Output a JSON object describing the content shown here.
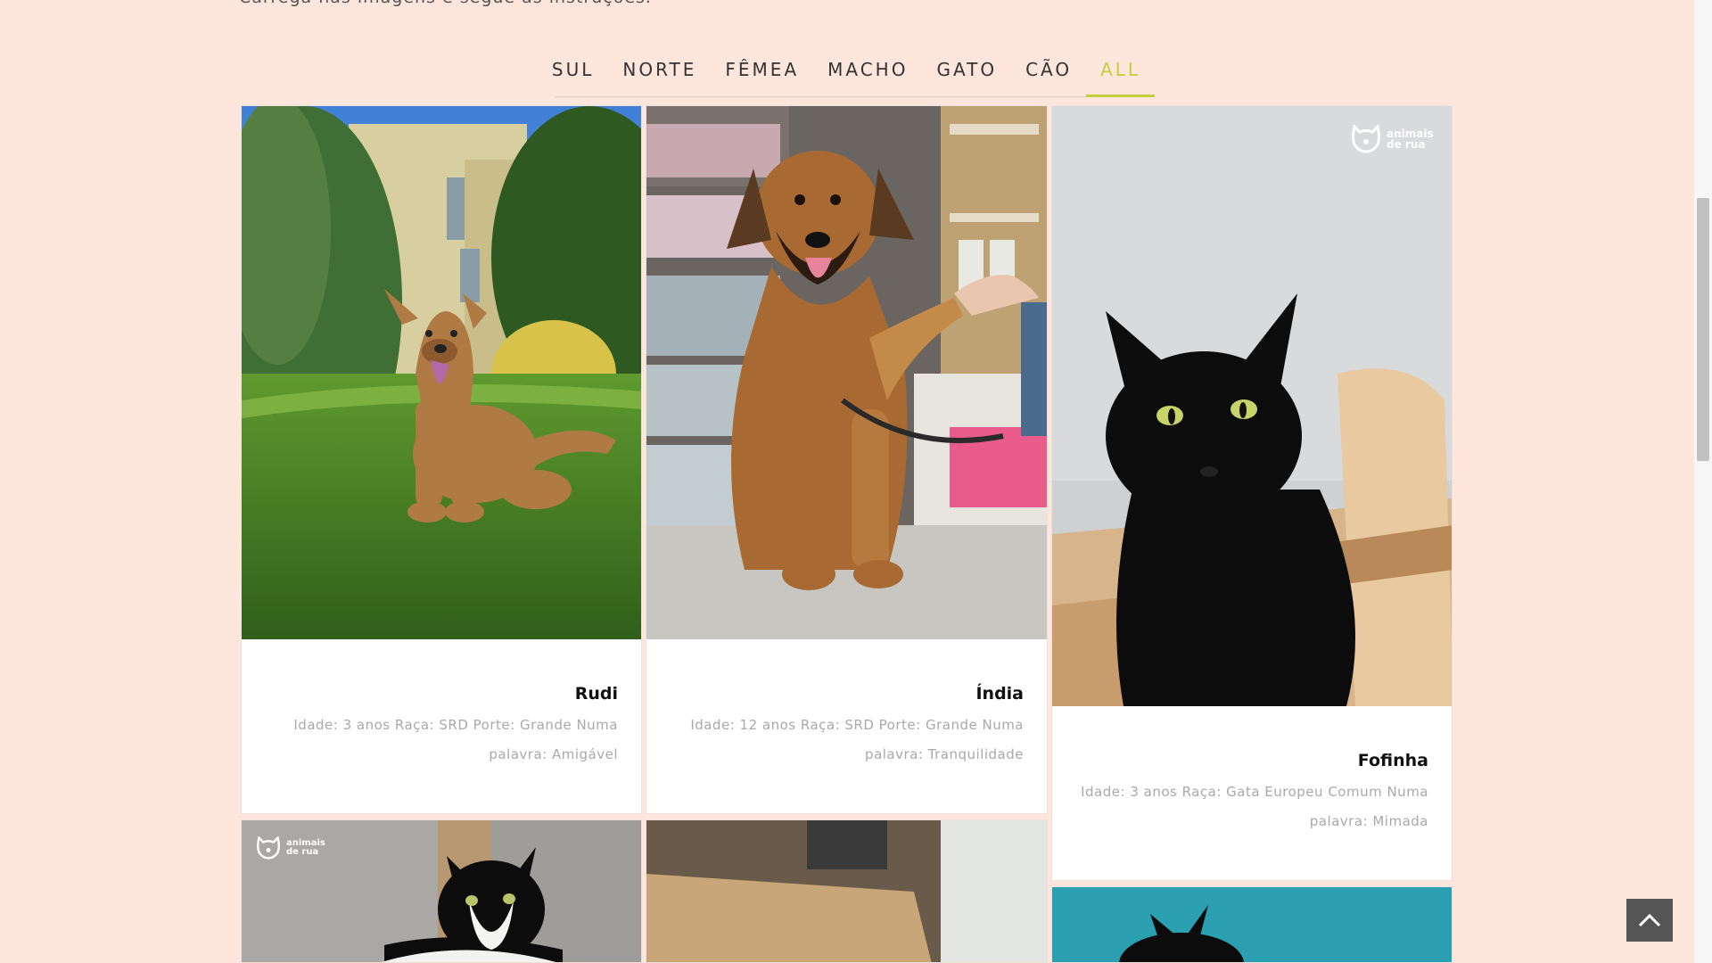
{
  "intro_text": "Carrega nas imagens e segue as instruções.",
  "filters": [
    {
      "label": "SUL"
    },
    {
      "label": "NORTE"
    },
    {
      "label": "FÊMEA"
    },
    {
      "label": "MACHO"
    },
    {
      "label": "GATO"
    },
    {
      "label": "CÃO"
    },
    {
      "label": "ALL"
    }
  ],
  "active_filter": "ALL",
  "logo_text": {
    "line1": "animais",
    "line2": "de rua"
  },
  "animals": [
    {
      "name": "Rudi",
      "desc_line1": "Idade: 3 anos Raça: SRD Porte: Grande Numa",
      "desc_line2": "palavra: Amigável"
    },
    {
      "name": "Índia",
      "desc_line1": "Idade: 12 anos Raça: SRD Porte: Grande Numa",
      "desc_line2": "palavra: Tranquilidade"
    },
    {
      "name": "Fofinha",
      "desc_line1": "Idade: 3 anos Raça: Gata Europeu Comum Numa",
      "desc_line2": "palavra: Mimada"
    }
  ],
  "colors": {
    "background": "#ffe6dc",
    "accent": "#c4cd3a",
    "name": "#111111",
    "desc": "#a9a9a9"
  },
  "icons": {
    "back_to_top": "chevron-up-icon",
    "logo": "cat-head-icon"
  }
}
